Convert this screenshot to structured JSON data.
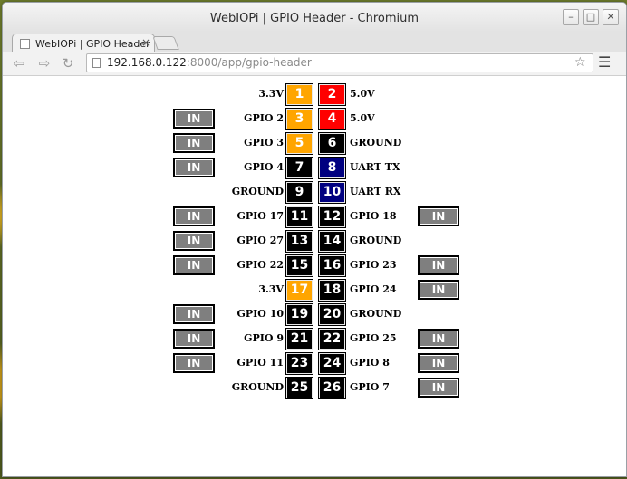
{
  "window": {
    "title": "WebIOPi | GPIO Header - Chromium",
    "buttons": {
      "minimize": "–",
      "maximize": "□",
      "close": "✕"
    }
  },
  "tab": {
    "title": "WebIOPi | GPIO Header",
    "close": "×"
  },
  "toolbar": {
    "url_host": "192.168.0.122",
    "url_rest": ":8000/app/gpio-header",
    "back_icon": "⇦",
    "forward_icon": "⇨",
    "reload_icon": "↻",
    "star_icon": "☆",
    "menu_icon": "☰"
  },
  "colors": {
    "power_3v3": "#ffa500",
    "power_5v": "#ff0000",
    "uart": "#000080",
    "gpio": "#000000",
    "io_button": "#7f7f7f"
  },
  "rows": [
    {
      "left": {
        "pin": "1",
        "label": "3.3V",
        "color": "#ffa500"
      },
      "right": {
        "pin": "2",
        "label": "5.0V",
        "color": "#ff0000"
      },
      "left_io": "",
      "right_io": ""
    },
    {
      "left": {
        "pin": "3",
        "label": "GPIO 2",
        "color": "#ffa500"
      },
      "right": {
        "pin": "4",
        "label": "5.0V",
        "color": "#ff0000"
      },
      "left_io": "IN",
      "right_io": ""
    },
    {
      "left": {
        "pin": "5",
        "label": "GPIO 3",
        "color": "#ffa500"
      },
      "right": {
        "pin": "6",
        "label": "GROUND",
        "color": "#000000"
      },
      "left_io": "IN",
      "right_io": ""
    },
    {
      "left": {
        "pin": "7",
        "label": "GPIO 4",
        "color": "#000000"
      },
      "right": {
        "pin": "8",
        "label": "UART TX",
        "color": "#000080"
      },
      "left_io": "IN",
      "right_io": ""
    },
    {
      "left": {
        "pin": "9",
        "label": "GROUND",
        "color": "#000000"
      },
      "right": {
        "pin": "10",
        "label": "UART RX",
        "color": "#000080"
      },
      "left_io": "",
      "right_io": ""
    },
    {
      "left": {
        "pin": "11",
        "label": "GPIO 17",
        "color": "#000000"
      },
      "right": {
        "pin": "12",
        "label": "GPIO 18",
        "color": "#000000"
      },
      "left_io": "IN",
      "right_io": "IN"
    },
    {
      "left": {
        "pin": "13",
        "label": "GPIO 27",
        "color": "#000000"
      },
      "right": {
        "pin": "14",
        "label": "GROUND",
        "color": "#000000"
      },
      "left_io": "IN",
      "right_io": ""
    },
    {
      "left": {
        "pin": "15",
        "label": "GPIO 22",
        "color": "#000000"
      },
      "right": {
        "pin": "16",
        "label": "GPIO 23",
        "color": "#000000"
      },
      "left_io": "IN",
      "right_io": "IN"
    },
    {
      "left": {
        "pin": "17",
        "label": "3.3V",
        "color": "#ffa500"
      },
      "right": {
        "pin": "18",
        "label": "GPIO 24",
        "color": "#000000"
      },
      "left_io": "",
      "right_io": "IN"
    },
    {
      "left": {
        "pin": "19",
        "label": "GPIO 10",
        "color": "#000000"
      },
      "right": {
        "pin": "20",
        "label": "GROUND",
        "color": "#000000"
      },
      "left_io": "IN",
      "right_io": ""
    },
    {
      "left": {
        "pin": "21",
        "label": "GPIO 9",
        "color": "#000000"
      },
      "right": {
        "pin": "22",
        "label": "GPIO 25",
        "color": "#000000"
      },
      "left_io": "IN",
      "right_io": "IN"
    },
    {
      "left": {
        "pin": "23",
        "label": "GPIO 11",
        "color": "#000000"
      },
      "right": {
        "pin": "24",
        "label": "GPIO 8",
        "color": "#000000"
      },
      "left_io": "IN",
      "right_io": "IN"
    },
    {
      "left": {
        "pin": "25",
        "label": "GROUND",
        "color": "#000000"
      },
      "right": {
        "pin": "26",
        "label": "GPIO 7",
        "color": "#000000"
      },
      "left_io": "",
      "right_io": "IN"
    }
  ]
}
